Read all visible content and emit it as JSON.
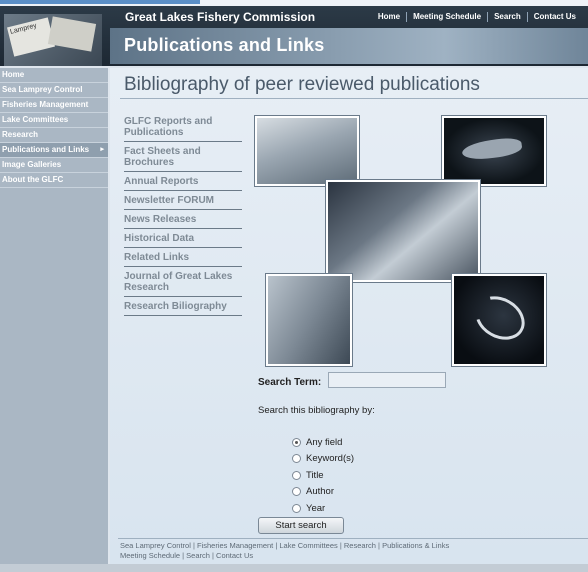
{
  "header": {
    "org_name": "Great Lakes Fishery Commission",
    "section_title": "Publications and Links",
    "top_nav": [
      "Home",
      "Meeting Schedule",
      "Search",
      "Contact Us"
    ],
    "logo_text": "Lamprey"
  },
  "sidebar": {
    "items": [
      {
        "label": "Home"
      },
      {
        "label": "Sea Lamprey Control"
      },
      {
        "label": "Fisheries Management"
      },
      {
        "label": "Lake Committees"
      },
      {
        "label": "Research"
      },
      {
        "label": "Publications and Links",
        "active": true,
        "arrow": "▸"
      },
      {
        "label": "Image Galleries"
      },
      {
        "label": "About the GLFC"
      }
    ]
  },
  "main": {
    "page_title": "Bibliography of peer reviewed publications",
    "subnav": [
      "GLFC Reports and Publications",
      "Fact Sheets and Brochures",
      "Annual Reports",
      "Newsletter FORUM",
      "News Releases",
      "Historical Data",
      "Related Links",
      "Journal of Great Lakes Research",
      "Research Biliography"
    ]
  },
  "search": {
    "term_label": "Search Term:",
    "term_value": "",
    "by_label": "Search this bibliography by:",
    "options": [
      "Any field",
      "Keyword(s)",
      "Title",
      "Author",
      "Year"
    ],
    "selected": "Any field",
    "button_label": "Start search"
  },
  "footer": {
    "line1": "Sea Lamprey Control | Fisheries Management | Lake Committees | Research | Publications & Links",
    "line2": "Meeting Schedule | Search | Contact Us"
  }
}
